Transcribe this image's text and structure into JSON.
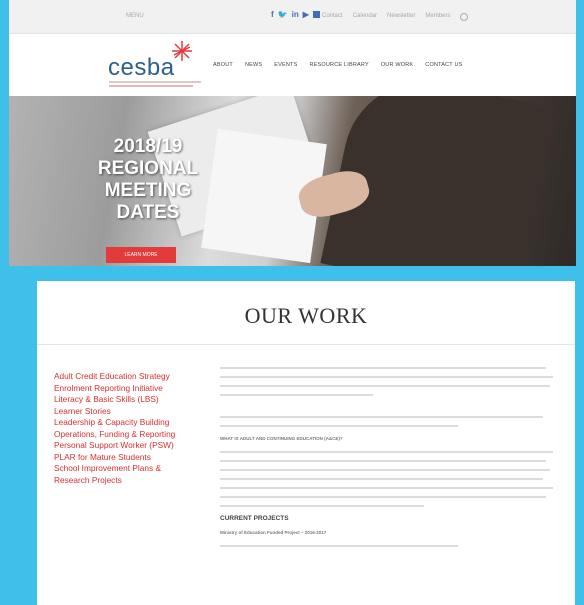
{
  "topbar": {
    "menu_label": "MENU",
    "links": [
      "Contact",
      "Calendar",
      "Newsletter",
      "Members"
    ]
  },
  "social_icons": [
    "facebook-icon",
    "twitter-icon",
    "linkedin-icon",
    "youtube-icon",
    "email-icon"
  ],
  "header": {
    "logo_text": "cesba",
    "nav": [
      "ABOUT",
      "NEWS",
      "EVENTS",
      "RESOURCE LIBRARY",
      "OUR WORK",
      "CONTACT US"
    ]
  },
  "hero": {
    "title_line1": "2018/19",
    "title_line2": "REGIONAL",
    "title_line3": "MEETING",
    "title_line4": "DATES",
    "button_label": "LEARN MORE"
  },
  "page": {
    "title": "OUR WORK",
    "sidebar": [
      "Adult Credit Education Strategy",
      "Enrolment Reporting Initiative",
      "Literacy & Basic Skills (LBS)",
      "Learner Stories",
      "Leadership & Capacity Building",
      "Operations, Funding & Reporting",
      "Personal Support Worker (PSW)",
      "PLAR for Mature Students",
      "School Improvement Plans &",
      "Research Projects"
    ],
    "question_heading": "WHAT IS ADULT AND CONTINUING EDUCATION (A&CE)?",
    "current_projects": "CURRENT PROJECTS",
    "project_title": "Ministry of Education Funded Project – 2016-2017"
  },
  "colors": {
    "page_bg": "#3fc0ea",
    "accent_red": "#d9302f",
    "logo_blue": "#2c5f8e"
  }
}
